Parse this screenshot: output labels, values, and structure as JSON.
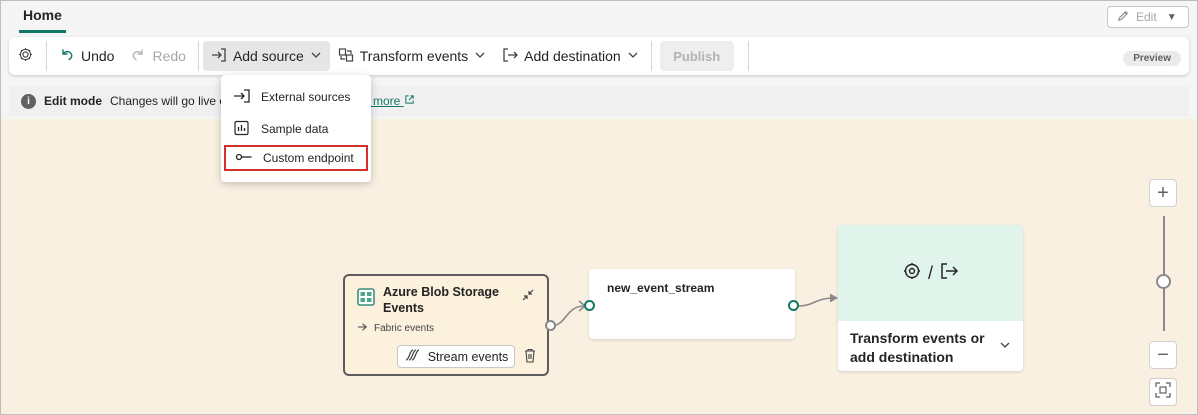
{
  "tabs": {
    "home": "Home"
  },
  "edit_button": {
    "label": "Edit"
  },
  "toolbar": {
    "undo": "Undo",
    "redo": "Redo",
    "add_source": "Add source",
    "transform_events": "Transform events",
    "add_destination": "Add destination",
    "publish": "Publish",
    "preview_badge": "Preview"
  },
  "infobar": {
    "title": "Edit mode",
    "message": "Changes will go live e",
    "link": "rn more"
  },
  "add_source_menu": {
    "items": [
      "External sources",
      "Sample data",
      "Custom endpoint"
    ],
    "highlighted": "Custom endpoint"
  },
  "source_node": {
    "title": "Azure Blob Storage Events",
    "subtitle": "Fabric events",
    "button": "Stream events"
  },
  "stream_node": {
    "title": "new_event_stream"
  },
  "destination_node": {
    "separator": "/",
    "label": "Transform events or add destination"
  },
  "colors": {
    "accent": "#117865",
    "canvas": "#faf0e2",
    "source_node_bg": "#fbf1dc",
    "destination_top": "#e0f4ec",
    "highlight_border": "#d32f2f"
  },
  "icons": {
    "settings": "gear-icon",
    "undo": "undo-icon",
    "redo": "redo-icon",
    "add_source": "arrow-into-box-icon",
    "transform": "transform-icon",
    "add_destination": "arrow-out-box-icon",
    "edit": "pencil-icon",
    "info": "info-icon",
    "external_source": "sign-in-icon",
    "sample_data": "chart-icon",
    "custom_endpoint": "endpoint-icon",
    "blob_storage": "storage-grid-icon",
    "collapse": "collapse-arrows-icon",
    "stream": "stream-icon",
    "delete": "trash-icon",
    "zoom_in": "plus-icon",
    "zoom_out": "minus-icon",
    "fit": "fit-view-icon"
  }
}
